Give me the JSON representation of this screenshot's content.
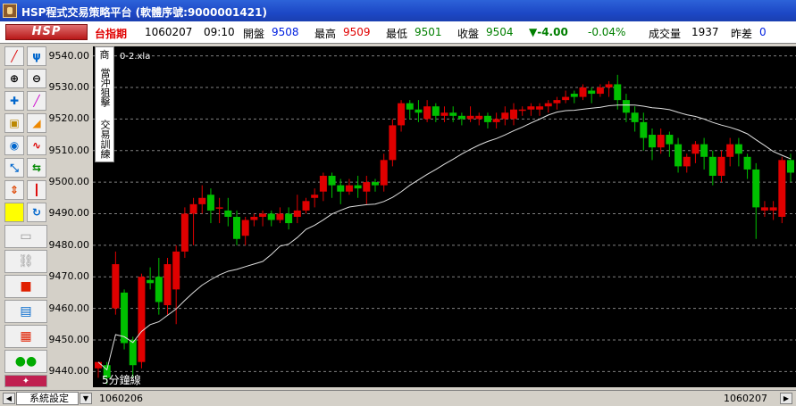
{
  "window": {
    "title": "HSP程式交易策略平台 (軟體序號:9000001421)"
  },
  "quote": {
    "logo": "HSP",
    "symbol": "台指期",
    "date": "1060207",
    "time": "09:10",
    "open_label": "開盤",
    "open": "9508",
    "high_label": "最高",
    "high": "9509",
    "low_label": "最低",
    "low": "9501",
    "close_label": "收盤",
    "close": "9504",
    "change": "▼-4.00",
    "change_pct": "-0.04%",
    "volume_label": "成交量",
    "volume": "1937",
    "prev_diff_label": "昨差",
    "prev_diff": "0"
  },
  "side_tabs": [
    {
      "label": "商"
    },
    {
      "label": "當沖狙擊"
    },
    {
      "label": "交易訓練"
    }
  ],
  "chart_info": {
    "file_label": "0-2.xla",
    "period_label": "5分鐘線"
  },
  "statusbar": {
    "settings_label": "系統設定",
    "start_date": "1060206",
    "end_date": "1060207"
  },
  "toolbar_icons": [
    "draw-line-icon",
    "fork-icon",
    "zoom-in-icon",
    "zoom-out-icon",
    "crosshair-icon",
    "pen-icon",
    "lock-icon",
    "eraser-icon",
    "target-icon",
    "wave-icon",
    "scale-icon",
    "stretch-icon",
    "arrow-up-down-icon",
    "candle-icon",
    "color-swatch-icon",
    "refresh-icon",
    "folder-icon",
    "chain-icon",
    "stop-icon",
    "window-icon",
    "grid-icon",
    "people-icon",
    "paint-icon"
  ],
  "colors": {
    "up": "#e00000",
    "down": "#00c000",
    "ma": "#e0e0e0",
    "grid": "#808080"
  },
  "chart_data": {
    "type": "candlestick",
    "title": "",
    "ylim": [
      9435,
      9543
    ],
    "y_ticks": [
      9540,
      9530,
      9520,
      9510,
      9500,
      9490,
      9480,
      9470,
      9460,
      9450,
      9440
    ],
    "candles": [
      [
        9441,
        9443,
        9438,
        9442
      ],
      [
        9442,
        9438,
        9436,
        9443
      ],
      [
        9460,
        9474,
        9458,
        9478
      ],
      [
        9465,
        9449,
        9447,
        9466
      ],
      [
        9450,
        9442,
        9438,
        9451
      ],
      [
        9443,
        9470,
        9441,
        9471
      ],
      [
        9469,
        9468,
        9466,
        9473
      ],
      [
        9470,
        9462,
        9458,
        9476
      ],
      [
        9461,
        9474,
        9458,
        9476
      ],
      [
        9466,
        9478,
        9455,
        9480
      ],
      [
        9478,
        9490,
        9476,
        9492
      ],
      [
        9490,
        9493,
        9480,
        9495
      ],
      [
        9493,
        9495,
        9490,
        9499
      ],
      [
        9496,
        9491,
        9487,
        9498
      ],
      [
        9492,
        9492,
        9487,
        9495
      ],
      [
        9491,
        9489,
        9486,
        9495
      ],
      [
        9489,
        9482,
        9480,
        9491
      ],
      [
        9483,
        9488,
        9480,
        9489
      ],
      [
        9488,
        9489,
        9486,
        9490
      ],
      [
        9489,
        9490,
        9486,
        9491
      ],
      [
        9490,
        9488,
        9486,
        9491
      ],
      [
        9488,
        9490,
        9487,
        9492
      ],
      [
        9490,
        9487,
        9485,
        9492
      ],
      [
        9489,
        9491,
        9487,
        9496
      ],
      [
        9491,
        9494,
        9490,
        9495
      ],
      [
        9495,
        9496,
        9492,
        9498
      ],
      [
        9497,
        9502,
        9494,
        9503
      ],
      [
        9502,
        9499,
        9495,
        9503
      ],
      [
        9499,
        9497,
        9493,
        9501
      ],
      [
        9497,
        9499,
        9496,
        9501
      ],
      [
        9499,
        9498,
        9495,
        9502
      ],
      [
        9497,
        9500,
        9493,
        9502
      ],
      [
        9500,
        9499,
        9497,
        9501
      ],
      [
        9499,
        9507,
        9497,
        9509
      ],
      [
        9507,
        9518,
        9505,
        9520
      ],
      [
        9518,
        9525,
        9516,
        9526
      ],
      [
        9525,
        9523,
        9520,
        9526
      ],
      [
        9523,
        9522,
        9519,
        9526
      ],
      [
        9520,
        9524,
        9519,
        9526
      ],
      [
        9524,
        9521,
        9519,
        9525
      ],
      [
        9521,
        9522,
        9519,
        9524
      ],
      [
        9522,
        9521,
        9519,
        9524
      ],
      [
        9521,
        9520,
        9518,
        9522
      ],
      [
        9520,
        9521,
        9519,
        9524
      ],
      [
        9520,
        9521,
        9518,
        9522
      ],
      [
        9521,
        9519,
        9517,
        9522
      ],
      [
        9519,
        9520,
        9517,
        9522
      ],
      [
        9520,
        9522,
        9518,
        9524
      ],
      [
        9520,
        9523,
        9518,
        9525
      ],
      [
        9523,
        9523,
        9521,
        9524
      ],
      [
        9523,
        9524,
        9521,
        9525
      ],
      [
        9523,
        9524,
        9521,
        9525
      ],
      [
        9524,
        9525,
        9522,
        9526
      ],
      [
        9525,
        9526,
        9523,
        9527
      ],
      [
        9526,
        9527,
        9525,
        9529
      ],
      [
        9528,
        9527,
        9525,
        9529
      ],
      [
        9527,
        9530,
        9526,
        9531
      ],
      [
        9529,
        9528,
        9525,
        9530
      ],
      [
        9528,
        9530,
        9527,
        9531
      ],
      [
        9530,
        9531,
        9527,
        9532
      ],
      [
        9531,
        9526,
        9523,
        9534
      ],
      [
        9526,
        9522,
        9519,
        9528
      ],
      [
        9522,
        9519,
        9516,
        9524
      ],
      [
        9519,
        9514,
        9510,
        9522
      ],
      [
        9515,
        9511,
        9507,
        9517
      ],
      [
        9511,
        9515,
        9509,
        9517
      ],
      [
        9515,
        9512,
        9508,
        9516
      ],
      [
        9512,
        9505,
        9503,
        9514
      ],
      [
        9505,
        9508,
        9503,
        9509
      ],
      [
        9509,
        9512,
        9506,
        9513
      ],
      [
        9512,
        9508,
        9504,
        9514
      ],
      [
        9508,
        9502,
        9499,
        9510
      ],
      [
        9502,
        9508,
        9500,
        9510
      ],
      [
        9508,
        9512,
        9505,
        9514
      ],
      [
        9512,
        9509,
        9505,
        9514
      ],
      [
        9508,
        9504,
        9501,
        9509
      ],
      [
        9504,
        9492,
        9482,
        9506
      ],
      [
        9491,
        9492,
        9489,
        9494
      ],
      [
        9491,
        9492,
        9488,
        9494
      ],
      [
        9489,
        9507,
        9487,
        9508
      ],
      [
        9507,
        9503,
        9500,
        9509
      ]
    ]
  }
}
